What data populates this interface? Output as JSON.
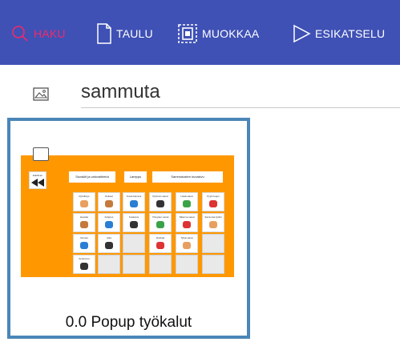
{
  "toolbar": {
    "haku_label": "HAKU",
    "taulu_label": "TAULU",
    "muokkaa_label": "MUOKKAA",
    "esikatselu_label": "ESIKATSELU",
    "colors": {
      "bar": "#3f51b5",
      "active": "#f02a6b",
      "text": "#ffffff"
    }
  },
  "search": {
    "value": "sammuta",
    "icon": "image-icon"
  },
  "results": [
    {
      "title": "0.0 Popup työkalut",
      "board": {
        "back_label": "Edellinen",
        "headers": [
          "Suosikit ja valovaihtelut",
          "Lamppu",
          "Sammutusten kuvasivu"
        ],
        "tiles": [
          "Ryhdistys",
          "Hiukset",
          "Kuvat kamera",
          "Ryhmän sanat",
          "Lisää sanat",
          "Pyyhi loppu",
          "Hauska",
          "Kuljetus",
          "Kosketus",
          "Yhteyden sanat",
          "Tallenna sanat",
          "Sammuta kytkin",
          "Ihmiset",
          "Aika",
          "",
          "Mykistä",
          "Tyhjä sanat",
          "",
          "Synkronoi",
          "",
          "",
          "",
          "",
          ""
        ]
      }
    }
  ]
}
